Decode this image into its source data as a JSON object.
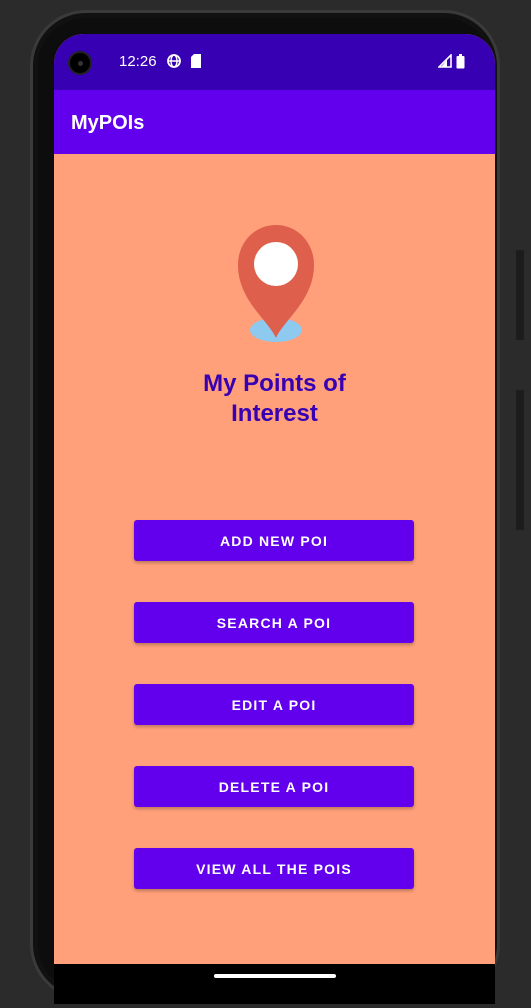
{
  "status_bar": {
    "time": "12:26",
    "icons_left": [
      "globe-icon",
      "sd-card-icon"
    ],
    "icons_right": [
      "signal-icon",
      "battery-icon"
    ]
  },
  "app_bar": {
    "title": "MyPOIs"
  },
  "main": {
    "logo_icon": "map-pin-icon",
    "heading": "My Points of\nInterest",
    "buttons": [
      {
        "label": "ADD NEW POI"
      },
      {
        "label": "SEARCH A POI"
      },
      {
        "label": "EDIT A POI"
      },
      {
        "label": "DELETE A POI"
      },
      {
        "label": "VIEW ALL THE POIS"
      }
    ]
  },
  "colors": {
    "status_bar": "#3700B3",
    "app_bar": "#6200EE",
    "background": "#FFA07A",
    "heading": "#3700B3",
    "button": "#6200EE",
    "pin_red": "#DE5F4B",
    "pin_shadow": "#8EC9F0"
  }
}
